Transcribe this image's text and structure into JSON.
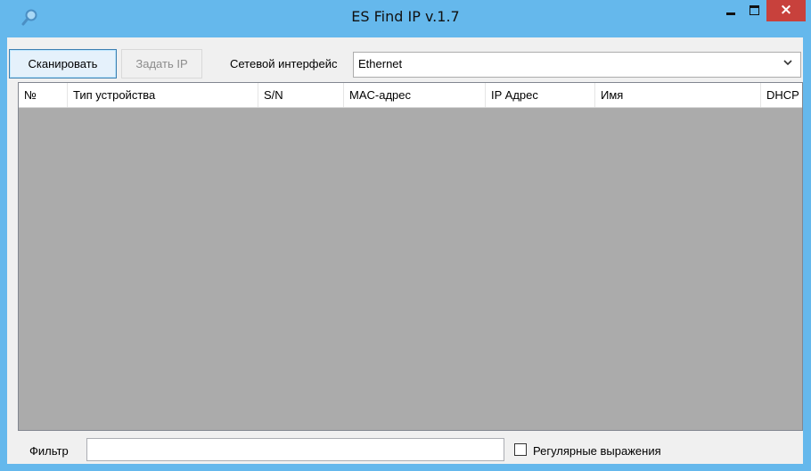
{
  "window": {
    "title": "ES Find IP v.1.7",
    "close_glyph": "×",
    "app_icon": "magnifier-icon",
    "colors": {
      "frame": "#65b8ec",
      "close": "#c8413c",
      "list_bg": "#ababab"
    }
  },
  "toolbar": {
    "scan_label": "Сканировать",
    "set_ip_label": "Задать IP",
    "interface_label": "Сетевой интерфейс",
    "interface_value": "Ethernet"
  },
  "table": {
    "columns": [
      "№",
      "Тип устройства",
      "S/N",
      "MAC-адрес",
      "IP Адрес",
      "Имя",
      "DHCP"
    ],
    "rows": []
  },
  "filter": {
    "label": "Фильтр",
    "value": "",
    "regex_label": "Регулярные выражения",
    "regex_checked": false
  }
}
